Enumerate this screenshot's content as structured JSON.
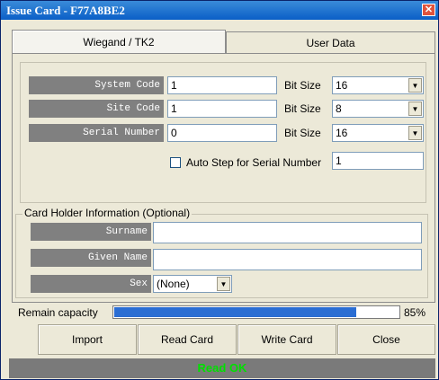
{
  "window": {
    "title": "Issue Card - F77A8BE2",
    "close_symbol": "✕"
  },
  "tabs": [
    {
      "label": "Wiegand / TK2"
    },
    {
      "label": "User Data"
    }
  ],
  "card": {
    "system_code": {
      "label": "System Code",
      "value": "1",
      "bit_size_label": "Bit Size",
      "bit_size": "16"
    },
    "site_code": {
      "label": "Site Code",
      "value": "1",
      "bit_size_label": "Bit Size",
      "bit_size": "8"
    },
    "serial_number": {
      "label": "Serial Number",
      "value": "0",
      "bit_size_label": "Bit Size",
      "bit_size": "16"
    },
    "auto_step": {
      "label": "Auto Step for Serial Number",
      "checked": false,
      "value": "1"
    }
  },
  "holder": {
    "group_title": "Card Holder Information (Optional)",
    "surname": {
      "label": "Surname",
      "value": ""
    },
    "given_name": {
      "label": "Given Name",
      "value": ""
    },
    "sex": {
      "label": "Sex",
      "value": "(None)"
    }
  },
  "capacity": {
    "label": "Remain capacity",
    "percent": 85,
    "percent_text": "85%"
  },
  "buttons": {
    "import": "Import",
    "read_card": "Read Card",
    "write_card": "Write Card",
    "close": "Close"
  },
  "status": {
    "text": "Read OK",
    "color": "#00e000"
  },
  "icons": {
    "dropdown": "▼"
  }
}
